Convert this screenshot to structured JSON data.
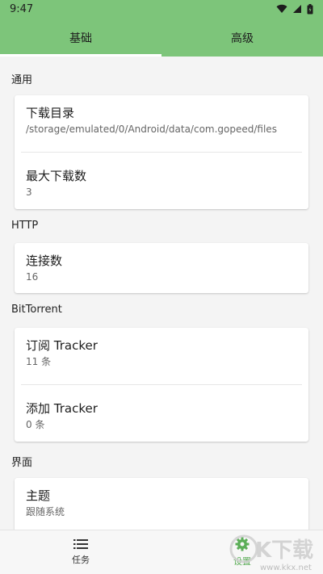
{
  "status_bar": {
    "time": "9:47"
  },
  "tabs": [
    {
      "label": "基础",
      "active": true
    },
    {
      "label": "高级",
      "active": false
    }
  ],
  "sections": {
    "general": {
      "title": "通用",
      "download_dir": {
        "title": "下载目录",
        "value": "/storage/emulated/0/Android/data/com.gopeed/files"
      },
      "max_downloads": {
        "title": "最大下载数",
        "value": "3"
      }
    },
    "http": {
      "title": "HTTP",
      "connections": {
        "title": "连接数",
        "value": "16"
      }
    },
    "bittorrent": {
      "title": "BitTorrent",
      "subscribe_tracker": {
        "title": "订阅 Tracker",
        "value": "11 条"
      },
      "add_tracker": {
        "title": "添加 Tracker",
        "value": "0 条"
      }
    },
    "ui": {
      "title": "界面",
      "theme": {
        "title": "主题",
        "value": "跟随系统"
      }
    }
  },
  "bottom_nav": [
    {
      "label": "任务",
      "icon": "list-icon",
      "active": false
    },
    {
      "label": "设置",
      "icon": "settings-icon",
      "active": true
    }
  ],
  "watermark": {
    "text": "K下载",
    "url": "www.kkx.net"
  },
  "colors": {
    "header": "#7dc57a",
    "accent_active": "#5cae58",
    "background": "#f4f4f4"
  }
}
